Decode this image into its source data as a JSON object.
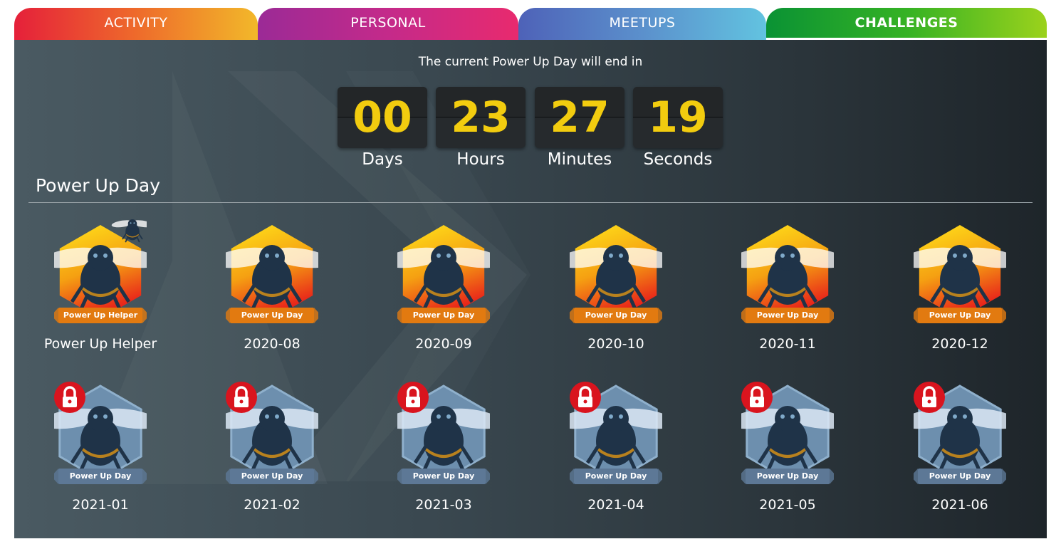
{
  "tabs": [
    {
      "label": "ACTIVITY"
    },
    {
      "label": "PERSONAL"
    },
    {
      "label": "MEETUPS"
    },
    {
      "label": "CHALLENGES"
    }
  ],
  "countdown": {
    "title": "The current Power Up Day will end in",
    "units": [
      {
        "value": "00",
        "label": "Days"
      },
      {
        "value": "23",
        "label": "Hours"
      },
      {
        "value": "27",
        "label": "Minutes"
      },
      {
        "value": "19",
        "label": "Seconds"
      }
    ]
  },
  "section": {
    "title": "Power Up Day"
  },
  "badges": [
    {
      "label": "Power Up Helper",
      "banner": "Power Up Helper",
      "state": "earned",
      "helper": true
    },
    {
      "label": "2020-08",
      "banner": "Power Up Day",
      "state": "earned"
    },
    {
      "label": "2020-09",
      "banner": "Power Up Day",
      "state": "earned"
    },
    {
      "label": "2020-10",
      "banner": "Power Up Day",
      "state": "earned"
    },
    {
      "label": "2020-11",
      "banner": "Power Up Day",
      "state": "earned"
    },
    {
      "label": "2020-12",
      "banner": "Power Up Day",
      "state": "earned"
    },
    {
      "label": "2021-01",
      "banner": "Power Up Day",
      "state": "locked"
    },
    {
      "label": "2021-02",
      "banner": "Power Up Day",
      "state": "locked"
    },
    {
      "label": "2021-03",
      "banner": "Power Up Day",
      "state": "locked"
    },
    {
      "label": "2021-04",
      "banner": "Power Up Day",
      "state": "locked"
    },
    {
      "label": "2021-05",
      "banner": "Power Up Day",
      "state": "locked"
    },
    {
      "label": "2021-06",
      "banner": "Power Up Day",
      "state": "locked"
    }
  ],
  "colors": {
    "countdown_digits": "#f2cc0f",
    "earned_hex_top": "#ffe21a",
    "earned_hex_bottom": "#e8231a",
    "earned_banner": "#e27a10",
    "locked_hex": "#6d8fae",
    "locked_banner": "#5d7896",
    "lock_red": "#d9141e"
  },
  "icons": {
    "bee": "bee-icon",
    "lock": "lock-icon"
  }
}
